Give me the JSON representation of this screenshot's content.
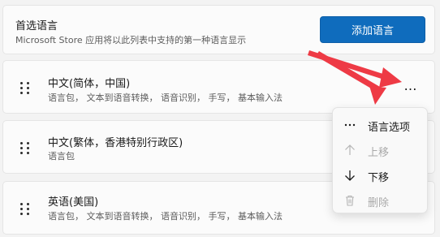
{
  "preferred": {
    "title": "首选语言",
    "subtitle": "Microsoft Store 应用将以此列表中支持的第一种语言显示",
    "add_button": "添加语言"
  },
  "languages": [
    {
      "name": "中文(简体，中国)",
      "features": "语言包， 文本到语音转换， 语音识别， 手写， 基本输入法"
    },
    {
      "name": "中文(繁体，香港特别行政区)",
      "features": "语言包"
    },
    {
      "name": "英语(美国)",
      "features": "语言包， 文本到语音转换， 语音识别， 手写， 基本输入法"
    }
  ],
  "more_button": "…",
  "context_menu": {
    "items": [
      {
        "label": "语言选项",
        "icon": "more-icon",
        "disabled": false
      },
      {
        "label": "上移",
        "icon": "arrow-up-icon",
        "disabled": true
      },
      {
        "label": "下移",
        "icon": "arrow-down-icon",
        "disabled": false
      },
      {
        "label": "删除",
        "icon": "trash-icon",
        "disabled": true
      }
    ]
  },
  "colors": {
    "accent": "#0f6cbd",
    "annotation_arrow": "#ee3a45"
  }
}
